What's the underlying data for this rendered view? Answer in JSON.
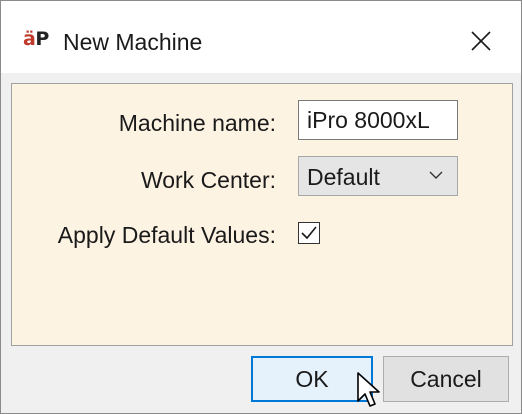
{
  "window": {
    "logo": "ap",
    "title": "New Machine"
  },
  "form": {
    "machine_name_label": "Machine name:",
    "machine_name_value": "iPro 8000xL",
    "work_center_label": "Work Center:",
    "work_center_value": "Default",
    "apply_defaults_label": "Apply Default Values:",
    "apply_defaults_checked": true
  },
  "buttons": {
    "ok_label": "OK",
    "cancel_label": "Cancel"
  },
  "icons": {
    "close": "close-icon",
    "dropdown": "chevron-down-icon",
    "checkbox": "check-icon",
    "cursor": "mouse-pointer-icon"
  },
  "colors": {
    "panel_background": "#fdf3e3",
    "accent_border": "#0078d7",
    "logo_accent": "#c0392b"
  }
}
